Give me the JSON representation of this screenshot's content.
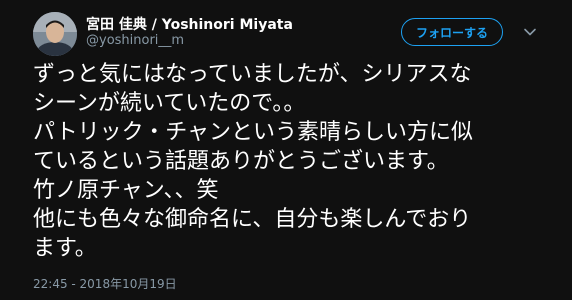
{
  "author": {
    "name": "宮田 佳典 / Yoshinori Miyata",
    "handle": "@yoshinori__m"
  },
  "follow_button": {
    "label": "フォローする"
  },
  "tweet": {
    "text": "ずっと気にはなっていましたが、シリアスな\nシーンが続いていたので。。\nパトリック・チャンという素晴らしい方に似\nているという話題ありがとうございます。\n竹ノ原チャン、、笑\n他にも色々な御命名に、自分も楽しんでおり\nます。",
    "timestamp": "22:45 - 2018年10月19日"
  },
  "colors": {
    "background": "#101010",
    "accent": "#1da1f2",
    "secondary_text": "#8899a6",
    "primary_text": "#ffffff"
  },
  "icons": {
    "avatar": "user-avatar-photo",
    "menu": "chevron-down-icon"
  }
}
